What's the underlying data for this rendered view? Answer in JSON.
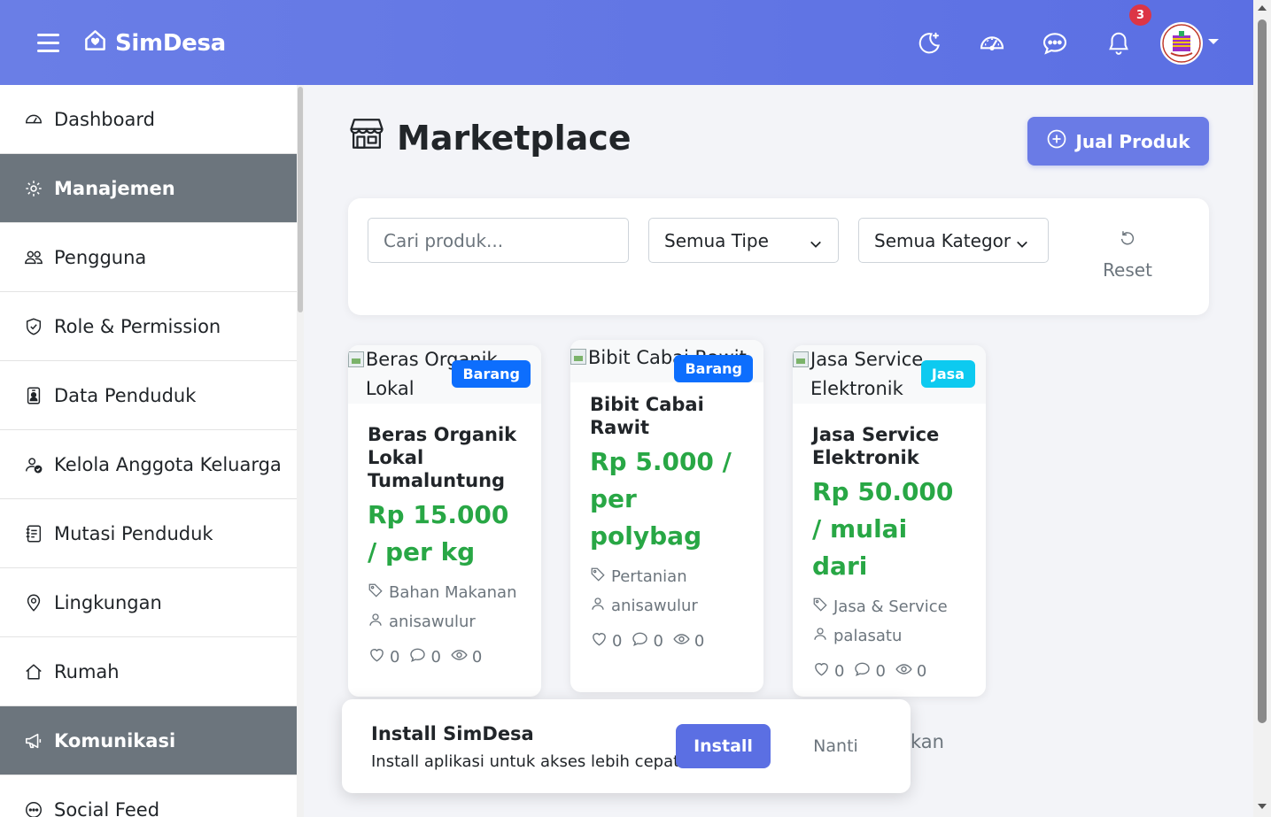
{
  "brand": {
    "name": "SimDesa"
  },
  "navbar": {
    "icons": [
      "moon-stars-icon",
      "speedometer-icon",
      "chat-dots-icon",
      "bell-icon"
    ],
    "notification_count": "3"
  },
  "sidebar": {
    "items": [
      {
        "label": "Dashboard",
        "icon": "speedometer-icon",
        "section": false
      },
      {
        "label": "Manajemen",
        "icon": "gear-icon",
        "section": true
      },
      {
        "label": "Pengguna",
        "icon": "people-icon",
        "section": false
      },
      {
        "label": "Role & Permission",
        "icon": "shield-check-icon",
        "section": false
      },
      {
        "label": "Data Penduduk",
        "icon": "person-badge-icon",
        "section": false
      },
      {
        "label": "Kelola Anggota Keluarga",
        "icon": "person-check-icon",
        "section": false
      },
      {
        "label": "Mutasi Penduduk",
        "icon": "journal-text-icon",
        "section": false
      },
      {
        "label": "Lingkungan",
        "icon": "geo-pin-icon",
        "section": false
      },
      {
        "label": "Rumah",
        "icon": "house-icon",
        "section": false
      },
      {
        "label": "Komunikasi",
        "icon": "megaphone-icon",
        "section": true
      },
      {
        "label": "Social Feed",
        "icon": "chat-icon",
        "section": false
      }
    ]
  },
  "page": {
    "title": "Marketplace",
    "sell_button": "Jual Produk"
  },
  "filters": {
    "search_placeholder": "Cari produk...",
    "type_select": "Semua Tipe",
    "category_select": "Semua Kategor",
    "reset_label": "Reset"
  },
  "products": [
    {
      "image_alt": "Beras Organik Lokal Tumaluntung",
      "badge": "Barang",
      "name": "Beras Organik Lokal Tumaluntung",
      "price": "Rp 15.000 / per kg",
      "category": "Bahan Makanan",
      "seller": "anisawulur",
      "likes": "0",
      "comments": "0",
      "views": "0"
    },
    {
      "image_alt": "Bibit Cabai Rawit",
      "badge": "Barang",
      "name": "Bibit Cabai Rawit",
      "price": "Rp 5.000 / per polybag",
      "category": "Pertanian",
      "seller": "anisawulur",
      "likes": "0",
      "comments": "0",
      "views": "0"
    },
    {
      "image_alt": "Jasa Service Elektronik",
      "badge": "Jasa",
      "name": "Jasa Service Elektronik",
      "price": "Rp 50.000 / mulai dari",
      "category": "Jasa & Service",
      "seller": "palasatu",
      "likes": "0",
      "comments": "0",
      "views": "0"
    }
  ],
  "install_prompt": {
    "title": "Install SimDesa",
    "subtitle": "Install aplikasi untuk akses lebih cepat",
    "install_button": "Install",
    "later_button": "Nanti",
    "obscured_text": "kan"
  },
  "colors": {
    "navbar": "#6a7ee6",
    "accent": "#5b6fe3",
    "price": "#28a745",
    "badge_barang": "#0d6efd",
    "badge_jasa": "#0dcaf0",
    "notification": "#dc3545",
    "section": "#6c757d"
  }
}
